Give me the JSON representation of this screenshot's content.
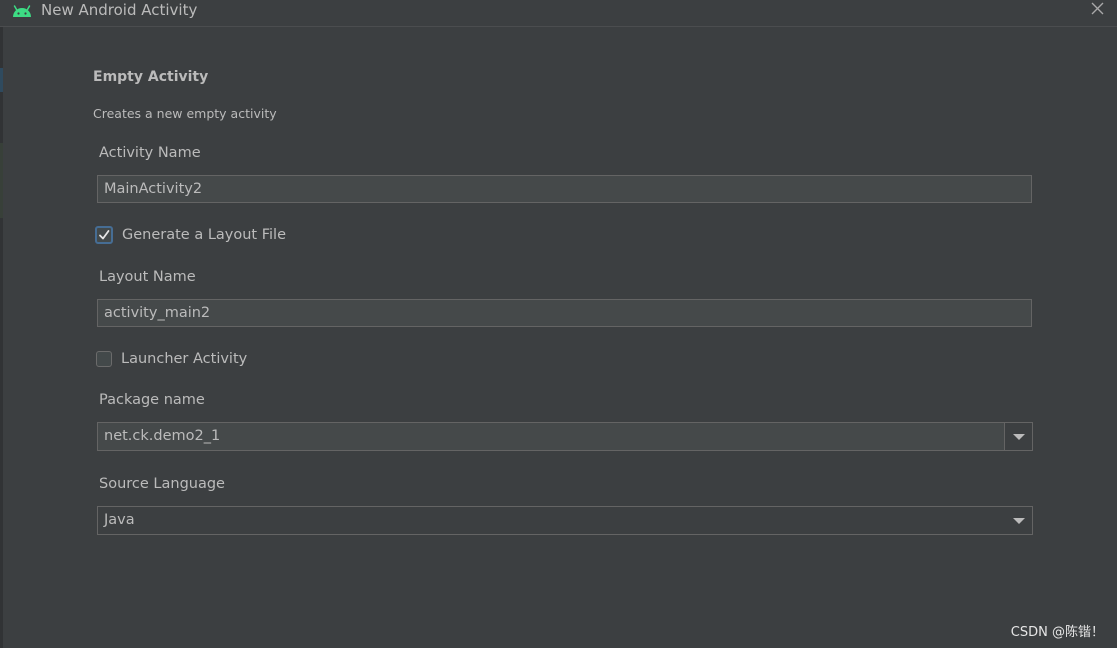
{
  "window": {
    "title": "New Android Activity",
    "icon": "android-icon",
    "close_icon": "close-icon"
  },
  "template": {
    "heading": "Empty Activity",
    "description": "Creates a new empty activity"
  },
  "form": {
    "activity_name": {
      "label": "Activity Name",
      "value": "MainActivity2"
    },
    "generate_layout": {
      "label": "Generate a Layout File",
      "checked": true
    },
    "layout_name": {
      "label": "Layout Name",
      "value": "activity_main2"
    },
    "launcher_activity": {
      "label": "Launcher Activity",
      "checked": false
    },
    "package_name": {
      "label": "Package name",
      "value": "net.ck.demo2_1"
    },
    "source_language": {
      "label": "Source Language",
      "value": "Java"
    }
  },
  "watermark": "CSDN @陈锴！",
  "colors": {
    "background": "#3c3f41",
    "field_background": "#45494a",
    "text": "#bbbbbb",
    "android_green": "#3ddc84",
    "focus_border": "#466d94"
  }
}
